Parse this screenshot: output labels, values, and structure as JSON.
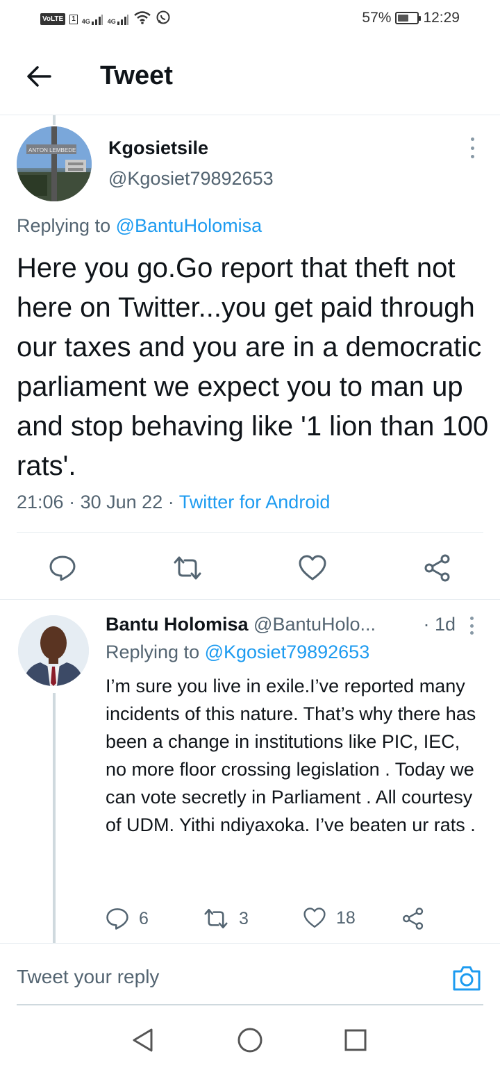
{
  "status_bar": {
    "volte": "VoLTE",
    "sim": "1",
    "network1": "4G",
    "network2": "4G",
    "battery": "57%",
    "battery_level": 0.57,
    "time": "12:29"
  },
  "header": {
    "title": "Tweet"
  },
  "main_tweet": {
    "author_name": "Kgosietsile",
    "author_handle": "@Kgosiet79892653",
    "replying_prefix": "Replying to",
    "replying_to": "@BantuHolomisa",
    "text": "Here you go.Go report that theft not here on Twitter...you get paid through our taxes and you are in a democratic parliament we expect you to man up and stop behaving like '1 lion than 100 rats'.",
    "time": "21:06",
    "date": "30 Jun 22",
    "sep": "·",
    "source": "Twitter for Android",
    "avatar_sign_text": "ANTON LEMBEDE"
  },
  "reply_tweet": {
    "author_name": "Bantu Holomisa",
    "author_handle": "@BantuHolo...",
    "age": "· 1d",
    "replying_prefix": "Replying to",
    "replying_to": "@Kgosiet79892653",
    "text": "I’m sure you live in exile.I’ve reported many incidents of this nature. That’s why there has been a change in institutions like PIC, IEC, no more floor crossing legislation . Today we can vote secretly in Parliament . All courtesy of UDM. Yithi ndiyaxoka. I’ve beaten ur rats .",
    "reply_count": "6",
    "retweet_count": "3",
    "like_count": "18"
  },
  "reply_bar": {
    "placeholder": "Tweet your reply"
  },
  "colors": {
    "accent": "#1d9bf0",
    "text": "#0f1419",
    "muted": "#536471",
    "border": "#e6ecf0"
  },
  "icons": {
    "back": "arrow-left-icon",
    "more": "more-vertical-icon",
    "reply": "speech-bubble-icon",
    "retweet": "retweet-icon",
    "like": "heart-icon",
    "share": "share-icon",
    "camera": "camera-icon",
    "nav_back": "triangle-back-icon",
    "nav_home": "circle-home-icon",
    "nav_recents": "square-recents-icon"
  }
}
